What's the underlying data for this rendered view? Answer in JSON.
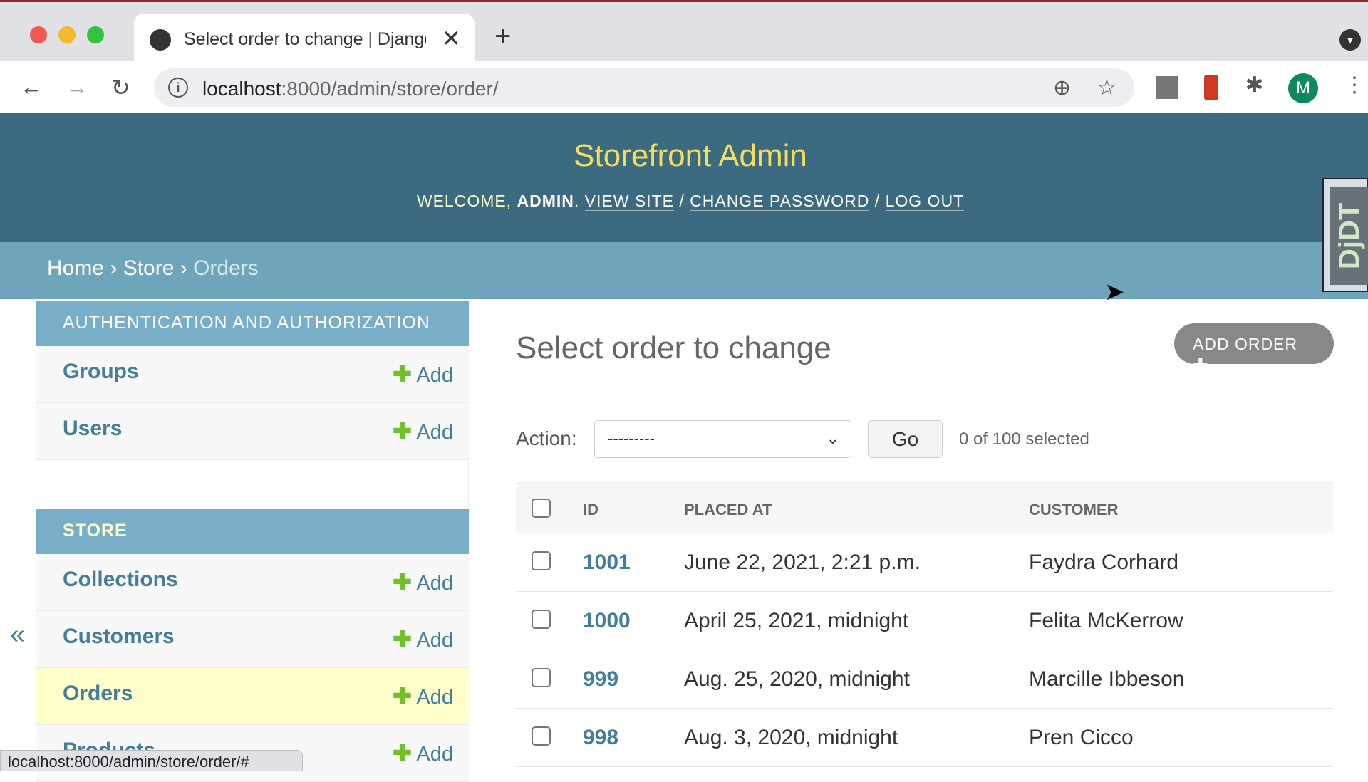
{
  "browser": {
    "tab_title": "Select order to change | Django",
    "url_host": "localhost",
    "url_rest": ":8000/admin/store/order/",
    "profile_initial": "M",
    "status_url": "localhost:8000/admin/store/order/#"
  },
  "header": {
    "site_title": "Storefront Admin",
    "welcome": "WELCOME,",
    "user": "ADMIN",
    "view_site": "VIEW SITE",
    "change_password": "CHANGE PASSWORD",
    "log_out": "LOG OUT",
    "djdt": "DjDT"
  },
  "breadcrumbs": {
    "home": "Home",
    "store": "Store",
    "current": "Orders"
  },
  "sidebar": {
    "auth_caption": "AUTHENTICATION AND AUTHORIZATION",
    "store_caption": "STORE",
    "add_label": "Add",
    "auth_items": [
      {
        "label": "Groups"
      },
      {
        "label": "Users"
      }
    ],
    "store_items": [
      {
        "label": "Collections"
      },
      {
        "label": "Customers"
      },
      {
        "label": "Orders"
      },
      {
        "label": "Products"
      }
    ],
    "collapse": "«"
  },
  "main": {
    "title": "Select order to change",
    "add_button": "ADD ORDER",
    "action_label": "Action:",
    "action_value": "---------",
    "go": "Go",
    "counter": "0 of 100 selected",
    "columns": [
      "ID",
      "PLACED AT",
      "CUSTOMER"
    ],
    "rows": [
      {
        "id": "1001",
        "placed_at": "June 22, 2021, 2:21 p.m.",
        "customer": "Faydra Corhard"
      },
      {
        "id": "1000",
        "placed_at": "April 25, 2021, midnight",
        "customer": "Felita McKerrow"
      },
      {
        "id": "999",
        "placed_at": "Aug. 25, 2020, midnight",
        "customer": "Marcille Ibbeson"
      },
      {
        "id": "998",
        "placed_at": "Aug. 3, 2020, midnight",
        "customer": "Pren Cicco"
      }
    ]
  }
}
